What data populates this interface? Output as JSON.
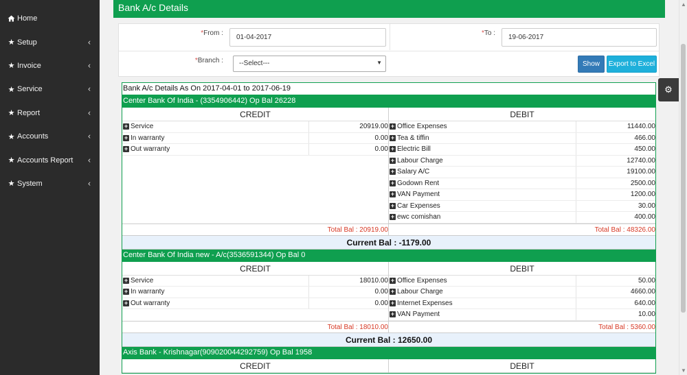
{
  "sidebar": {
    "items": [
      {
        "label": "Home",
        "icon": "home-icon",
        "has_submenu": false
      },
      {
        "label": "Setup",
        "icon": "star-icon",
        "has_submenu": true
      },
      {
        "label": "Invoice",
        "icon": "star-icon",
        "has_submenu": true
      },
      {
        "label": "Service",
        "icon": "star-icon",
        "has_submenu": true
      },
      {
        "label": "Report",
        "icon": "star-icon",
        "has_submenu": true
      },
      {
        "label": "Accounts",
        "icon": "star-icon",
        "has_submenu": true
      },
      {
        "label": "Accounts Report",
        "icon": "star-icon",
        "has_submenu": true
      },
      {
        "label": "System",
        "icon": "star-icon",
        "has_submenu": true
      }
    ]
  },
  "page": {
    "title": "Bank A/c Details"
  },
  "filters": {
    "from_label": "From :",
    "from_value": "01-04-2017",
    "to_label": "To :",
    "to_value": "19-06-2017",
    "branch_label": "Branch :",
    "branch_value": "--Select---",
    "required_mark": "*",
    "show_button": "Show",
    "export_button": "Export to Excel"
  },
  "report": {
    "title": "Bank A/c Details As On 2017-04-01 to 2017-06-19",
    "credit_label": "CREDIT",
    "debit_label": "DEBIT",
    "banks": [
      {
        "header": "Center Bank Of India - (3354906442) Op Bal 26228",
        "credit": [
          {
            "name": "Service",
            "amount": "20919.00"
          },
          {
            "name": "In warranty",
            "amount": "0.00"
          },
          {
            "name": "Out warranty",
            "amount": "0.00"
          }
        ],
        "debit": [
          {
            "name": "Office Expenses",
            "amount": "11440.00"
          },
          {
            "name": "Tea & tiffin",
            "amount": "466.00"
          },
          {
            "name": "Electric Bill",
            "amount": "450.00"
          },
          {
            "name": "Labour Charge",
            "amount": "12740.00"
          },
          {
            "name": "Salary A/C",
            "amount": "19100.00"
          },
          {
            "name": "Godown Rent",
            "amount": "2500.00"
          },
          {
            "name": "VAN Payment",
            "amount": "1200.00"
          },
          {
            "name": "Car Expenses",
            "amount": "30.00"
          },
          {
            "name": "ewc comishan",
            "amount": "400.00"
          }
        ],
        "credit_total": "Total Bal : 20919.00",
        "debit_total": "Total Bal : 48326.00",
        "current_bal": "Current Bal : -1179.00"
      },
      {
        "header": "Center Bank Of India new - A/c(3536591344) Op Bal 0",
        "credit": [
          {
            "name": "Service",
            "amount": "18010.00"
          },
          {
            "name": "In warranty",
            "amount": "0.00"
          },
          {
            "name": "Out warranty",
            "amount": "0.00"
          }
        ],
        "debit": [
          {
            "name": "Office Expenses",
            "amount": "50.00"
          },
          {
            "name": "Labour Charge",
            "amount": "4660.00"
          },
          {
            "name": "Internet Expenses",
            "amount": "640.00"
          },
          {
            "name": "VAN Payment",
            "amount": "10.00"
          }
        ],
        "credit_total": "Total Bal : 18010.00",
        "debit_total": "Total Bal : 5360.00",
        "current_bal": "Current Bal : 12650.00"
      },
      {
        "header": "Axis Bank - Krishnagar(909020044292759) Op Bal 1958",
        "credit": [],
        "debit": []
      }
    ]
  }
}
